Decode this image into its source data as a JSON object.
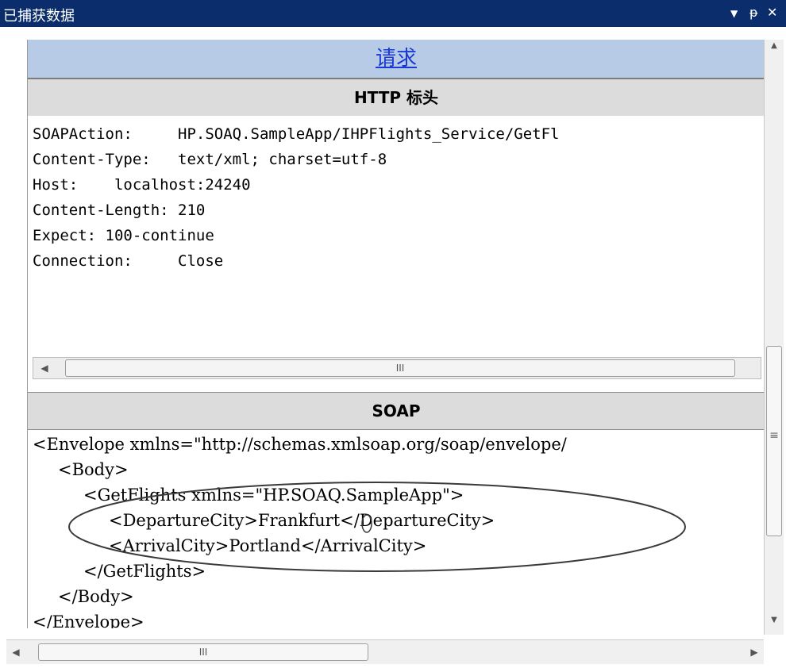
{
  "window": {
    "title": "已捕获数据",
    "dropdown_glyph": "▼",
    "pin_glyph": "ᵽ",
    "close_glyph": "✕"
  },
  "request": {
    "heading": "请求"
  },
  "http": {
    "header": "HTTP 标头",
    "lines": [
      {
        "key": "SOAPAction:     ",
        "value": "HP.SOAQ.SampleApp/IHPFlights_Service/GetFl"
      },
      {
        "key": "Content-Type:   ",
        "value": "text/xml; charset=utf-8"
      },
      {
        "key": "Host:    ",
        "value": "localhost:24240"
      },
      {
        "key": "Content-Length: ",
        "value": "210"
      },
      {
        "key": "Expect: ",
        "value": "100-continue"
      },
      {
        "key": "Connection:     ",
        "value": "Close"
      }
    ],
    "scroll_left_glyph": "◀",
    "scroll_thumb_grip": "III"
  },
  "soap": {
    "header": "SOAP",
    "lines": [
      "<Envelope xmlns=\"http://schemas.xmlsoap.org/soap/envelope/",
      "<Body>",
      "<GetFlights xmlns=\"HP.SOAQ.SampleApp\">",
      "<DepartureCity>Frankfurt</DepartureCity>",
      "<ArrivalCity>Portland</ArrivalCity>",
      "</GetFlights>",
      "</Body>",
      "</Envelope>"
    ]
  },
  "vscroll": {
    "up_glyph": "▲",
    "down_glyph": "▼",
    "grip_glyph": "≡"
  },
  "hscroll": {
    "left_glyph": "◀",
    "right_glyph": "▶",
    "grip": "III"
  }
}
